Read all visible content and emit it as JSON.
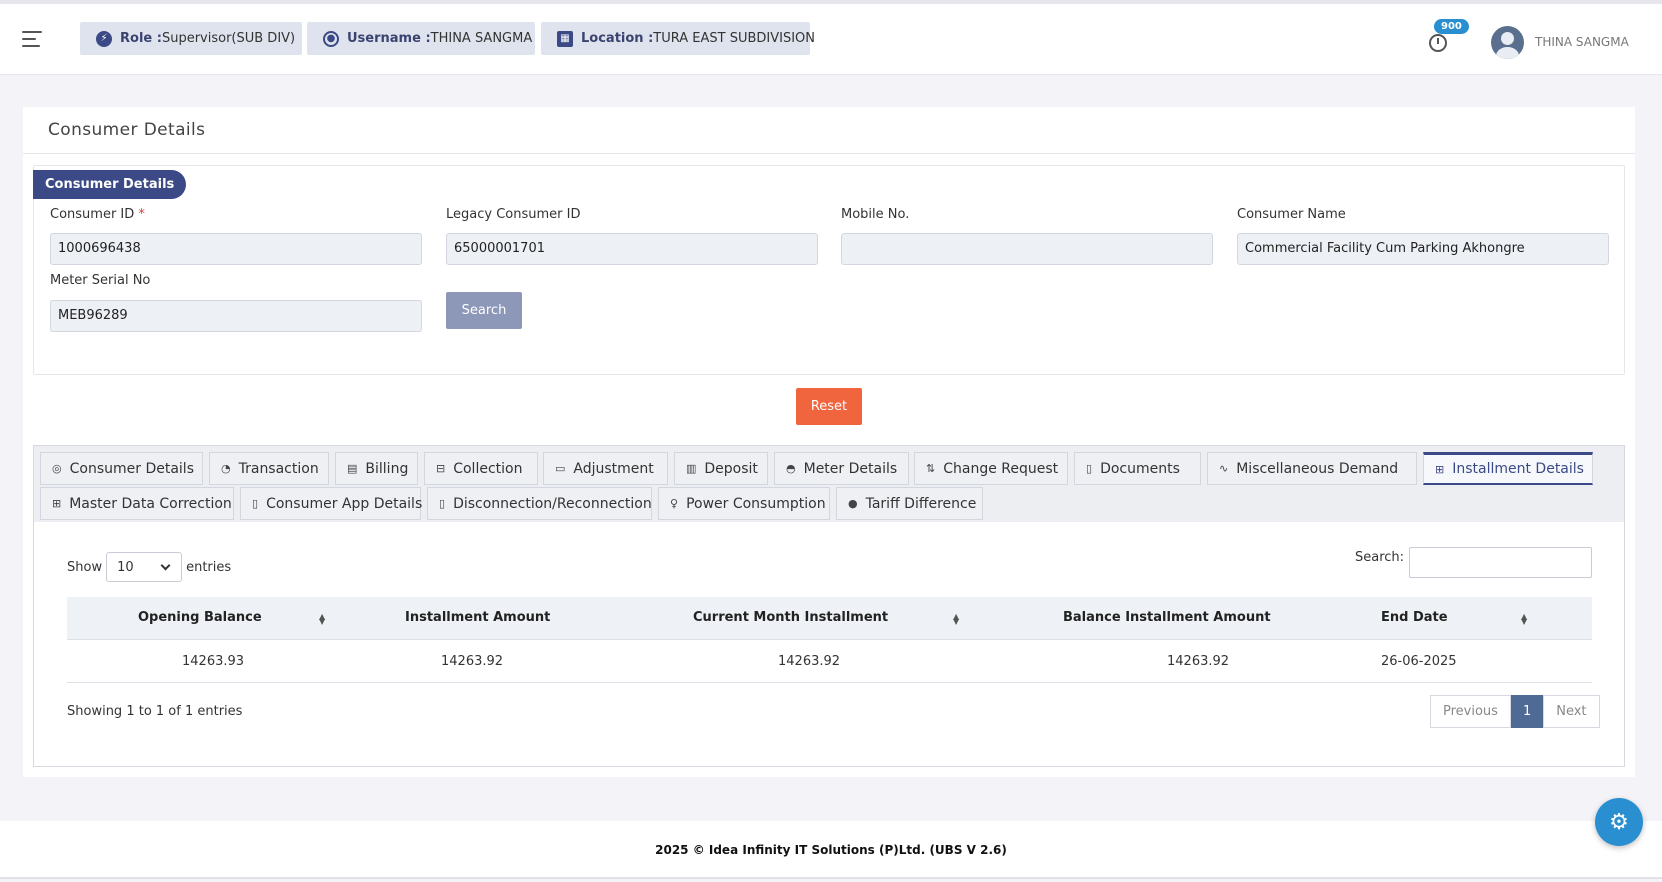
{
  "header": {
    "role_label": "Role :",
    "role_value": "Supervisor(SUB DIV)",
    "username_label": "Username :",
    "username_value": "THINA SANGMA",
    "location_label": "Location :",
    "location_value": "TURA EAST SUBDIVISION",
    "notification_count": "900",
    "user_name": "THINA SANGMA"
  },
  "page": {
    "title": "Consumer Details"
  },
  "form": {
    "legend": "Consumer Details",
    "consumer_id_label": "Consumer ID",
    "required_mark": "*",
    "consumer_id_value": "1000696438",
    "legacy_id_label": "Legacy Consumer ID",
    "legacy_id_value": "65000001701",
    "mobile_label": "Mobile No.",
    "mobile_value": "",
    "consumer_name_label": "Consumer Name",
    "consumer_name_value": "Commercial Facility Cum Parking Akhongre",
    "meter_serial_label": "Meter Serial No",
    "meter_serial_value": "MEB96289",
    "search_button": "Search",
    "reset_button": "Reset"
  },
  "tabs": [
    {
      "label": "Consumer Details",
      "icon": "target-icon"
    },
    {
      "label": "Transaction",
      "icon": "pie-icon"
    },
    {
      "label": "Billing",
      "icon": "billing-icon"
    },
    {
      "label": "Collection",
      "icon": "collection-icon"
    },
    {
      "label": "Adjustment",
      "icon": "adjustment-icon"
    },
    {
      "label": "Deposit",
      "icon": "bank-icon"
    },
    {
      "label": "Meter Details",
      "icon": "gauge-icon"
    },
    {
      "label": "Change Request",
      "icon": "git-pull-icon"
    },
    {
      "label": "Documents",
      "icon": "document-icon"
    },
    {
      "label": "Miscellaneous Demand",
      "icon": "pulse-icon"
    },
    {
      "label": "Installment Details",
      "icon": "installment-icon",
      "active": true
    },
    {
      "label": "Master Data Correction",
      "icon": "master-data-icon"
    },
    {
      "label": "Consumer App Details",
      "icon": "mobile-icon"
    },
    {
      "label": "Disconnection/Reconnection",
      "icon": "mobile-icon"
    },
    {
      "label": "Power Consumption",
      "icon": "bulb-icon"
    },
    {
      "label": "Tariff Difference",
      "icon": "circle-icon"
    }
  ],
  "table": {
    "show_label": "Show",
    "entries_value": "10",
    "entries_label": "entries",
    "search_label": "Search:",
    "columns": [
      "Opening Balance",
      "Installment Amount",
      "Current Month Installment",
      "Balance Installment Amount",
      "End Date"
    ],
    "rows": [
      [
        "14263.93",
        "14263.92",
        "14263.92",
        "14263.92",
        "26-06-2025"
      ]
    ],
    "info": "Showing 1 to 1 of 1 entries",
    "prev_label": "Previous",
    "current_page": "1",
    "next_label": "Next"
  },
  "footer": {
    "text": "2025 © Idea Infinity IT Solutions (P)Ltd. (UBS V 2.6)"
  },
  "colors": {
    "primary": "#3b4a86",
    "reset": "#f0643e",
    "fab": "#2a8fd0"
  }
}
